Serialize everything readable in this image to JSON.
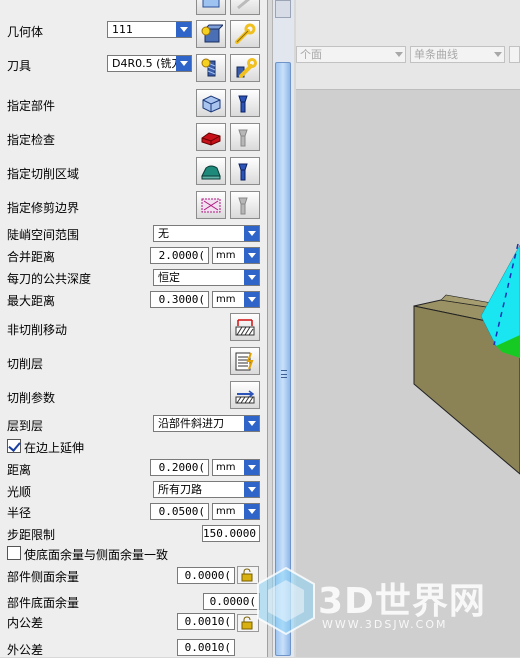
{
  "rows": {
    "geometry": {
      "label": "几何体",
      "value": "111"
    },
    "tool": {
      "label": "刀具",
      "value": "D4R0.5 (铣刀"
    },
    "specify_part": {
      "label": "指定部件"
    },
    "specify_check": {
      "label": "指定检查"
    },
    "specify_cut_area": {
      "label": "指定切削区域"
    },
    "specify_trim": {
      "label": "指定修剪边界"
    },
    "steep_range": {
      "label": "陡峭空间范围",
      "value": "无"
    },
    "merge_distance": {
      "label": "合并距离",
      "value": "2.0000(",
      "unit": "mm"
    },
    "common_depth": {
      "label": "每刀的公共深度",
      "value": "恒定"
    },
    "max_distance": {
      "label": "最大距离",
      "value": "0.3000(",
      "unit": "mm"
    },
    "non_cutting": {
      "label": "非切削移动"
    },
    "cut_levels": {
      "label": "切削层"
    },
    "cut_params": {
      "label": "切削参数"
    },
    "level_to_level": {
      "label": "层到层",
      "value": "沿部件斜进刀"
    },
    "extend_at_edges": {
      "label": "在边上延伸",
      "checked": true
    },
    "distance": {
      "label": "距离",
      "value": "0.2000(",
      "unit": "mm"
    },
    "smoothing": {
      "label": "光顺",
      "value": "所有刀路"
    },
    "radius": {
      "label": "半径",
      "value": "0.0500(",
      "unit": "mm"
    },
    "stepover_limit": {
      "label": "步距限制",
      "value": "150.0000"
    },
    "same_stock": {
      "label": "使底面余量与侧面余量一致",
      "checked": false
    },
    "part_side_stock": {
      "label": "部件侧面余量",
      "value": "0.0000("
    },
    "part_floor_stock": {
      "label": "部件底面余量",
      "value": "0.0000("
    },
    "intol": {
      "label": "内公差",
      "value": "0.0010("
    },
    "outtol": {
      "label": "外公差",
      "value": "0.0010("
    }
  },
  "viewport": {
    "combo_left": "个面",
    "combo_right": "单条曲线"
  },
  "watermark": {
    "brand": "3D世界网",
    "url": "WWW.3DSJW.COM"
  },
  "colors": {
    "accent": "#2f64c8",
    "solid": "#8c8455",
    "tool_cyan": "#19e6f0",
    "tool_green": "#17c923"
  }
}
